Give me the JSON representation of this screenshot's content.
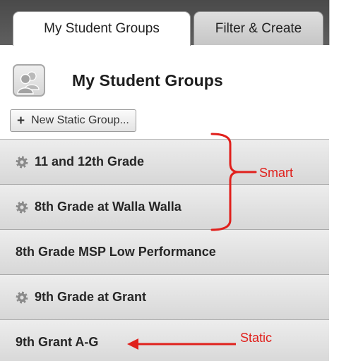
{
  "tabs": [
    {
      "label": "My Student Groups",
      "active": true
    },
    {
      "label": "Filter & Create",
      "active": false
    }
  ],
  "header": {
    "title": "My Student Groups",
    "icon": "people-group-icon"
  },
  "new_group_button": {
    "plus": "+",
    "label": "New Static Group..."
  },
  "groups": [
    {
      "label": "11 and 12th Grade",
      "type": "smart"
    },
    {
      "label": "8th Grade at Walla Walla",
      "type": "smart"
    },
    {
      "label": "8th Grade MSP Low Performance",
      "type": "static"
    },
    {
      "label": "9th Grade at Grant",
      "type": "smart"
    },
    {
      "label": "9th Grant A-G",
      "type": "static"
    }
  ],
  "annotations": {
    "smart_label": "Smart",
    "static_label": "Static",
    "color": "#e0201c"
  }
}
